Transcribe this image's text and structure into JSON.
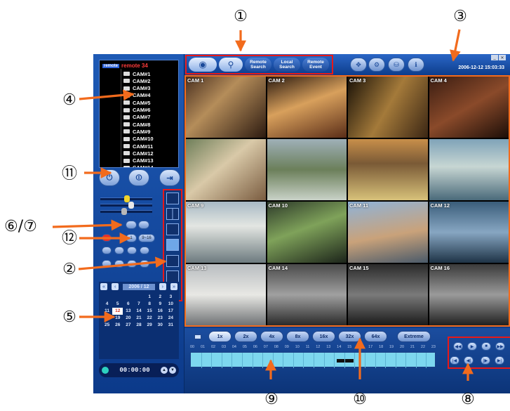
{
  "callouts": {
    "c1": "①",
    "c2": "②",
    "c3": "③",
    "c4": "④",
    "c5": "⑤",
    "c67": "⑥/⑦",
    "c8": "⑧",
    "c9": "⑨",
    "c10": "⑩",
    "c11": "⑪",
    "c12": "⑫"
  },
  "toolbar": {
    "remote_search": "Remote Search",
    "local_search": "Local Search",
    "remote_event": "Remote Event",
    "datetime": "2006-12-12 15:03:33"
  },
  "tree": {
    "root_tag": "remote",
    "root_label": "remote 34",
    "cameras": [
      "CAM#1",
      "CAM#2",
      "CAM#3",
      "CAM#4",
      "CAM#5",
      "CAM#6",
      "CAM#7",
      "CAM#8",
      "CAM#9",
      "CAM#10",
      "CAM#11",
      "CAM#12",
      "CAM#13",
      "CAM#14"
    ]
  },
  "pad": {
    "btn_a": "1",
    "btn_b": "9~16"
  },
  "calendar": {
    "title": "2006 / 12",
    "days": [
      "",
      "",
      "",
      "",
      "1",
      "2",
      "3",
      "4",
      "5",
      "6",
      "7",
      "8",
      "9",
      "10",
      "11",
      "12",
      "13",
      "14",
      "15",
      "16",
      "17",
      "18",
      "19",
      "20",
      "21",
      "22",
      "23",
      "24",
      "25",
      "26",
      "27",
      "28",
      "29",
      "30",
      "31",
      "",
      ""
    ],
    "selected": "12"
  },
  "clock": "00:00:00",
  "cameras": [
    "CAM 1",
    "CAM 2",
    "CAM 3",
    "CAM 4",
    "",
    "",
    "",
    "",
    "CAM 9",
    "CAM 10",
    "CAM 11",
    "CAM 12",
    "CAM 13",
    "CAM 14",
    "CAM 15",
    "CAM 16"
  ],
  "speeds": [
    "1x",
    "2x",
    "4x",
    "8x",
    "16x",
    "32x",
    "64x",
    "Extreme"
  ],
  "hours": [
    "00",
    "01",
    "02",
    "03",
    "04",
    "05",
    "06",
    "07",
    "08",
    "09",
    "10",
    "11",
    "12",
    "13",
    "14",
    "15",
    "16",
    "17",
    "18",
    "19",
    "20",
    "21",
    "22",
    "23"
  ],
  "colors": {
    "accent_orange": "#f26b1d",
    "highlight_red": "#e81818",
    "panel_blue": "#0d3d8c"
  }
}
